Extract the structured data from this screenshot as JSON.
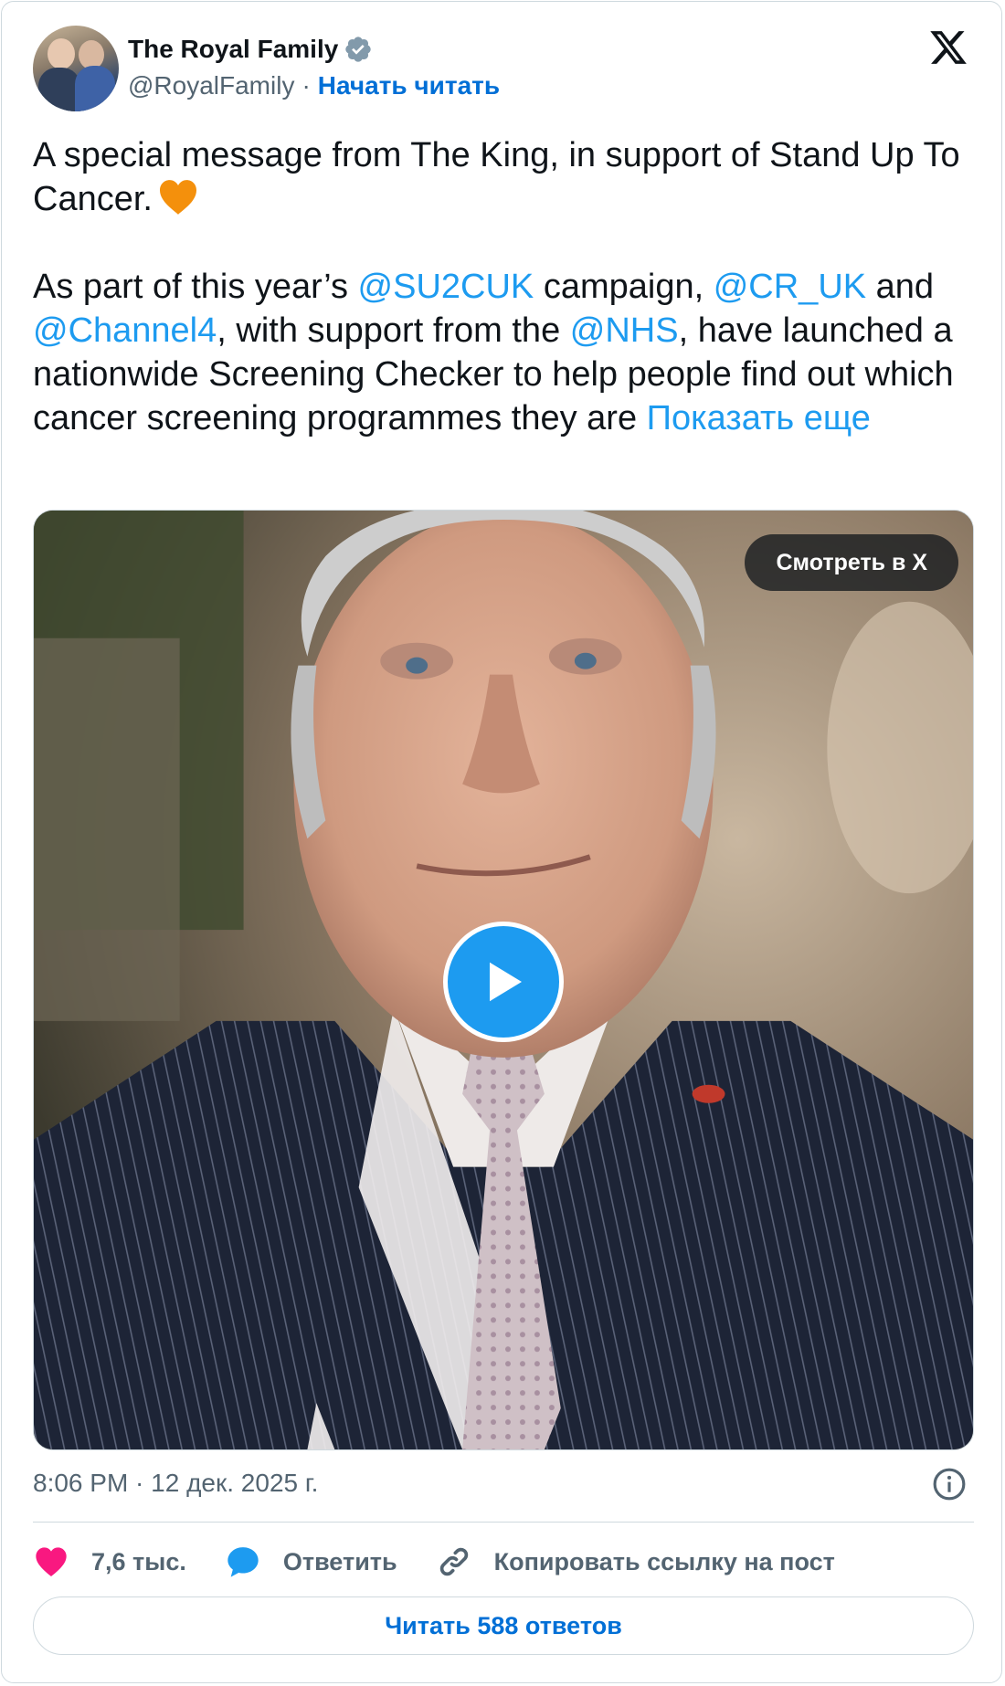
{
  "author": {
    "name": "The Royal Family",
    "handle": "@RoyalFamily",
    "separator": "·",
    "follow_label": "Начать читать"
  },
  "tweet": {
    "line1_text": "A special message from The King, in support of Stand Up To Cancer.",
    "line1_emoji": "orange-heart",
    "p2_part1": "As part of this year’s ",
    "m1": "@SU2CUK",
    "p2_part2": " campaign, ",
    "m2": "@CR_UK",
    "p2_part3": " and ",
    "m3": "@Channel4",
    "p2_part4": ", with support from the ",
    "m4": "@NHS",
    "p2_part5": ", have launched a nationwide Screening Checker to help people find out which cancer screening programmes they are ",
    "show_more": "Показать еще"
  },
  "media": {
    "watch_label": "Смотреть в X",
    "play_icon": "play-icon"
  },
  "timestamp": "8:06 PM · 12 дек. 2025 г.",
  "actions": {
    "likes": "7,6 тыс.",
    "reply": "Ответить",
    "copy_link": "Копировать ссылку на пост"
  },
  "read_replies": "Читать 588 ответов",
  "colors": {
    "link": "#1d9bf0",
    "follow": "#006fd6",
    "like": "#f91880",
    "reply_bubble": "#1d9bf0",
    "muted": "#536471",
    "emoji_heart": "#f4900c"
  }
}
